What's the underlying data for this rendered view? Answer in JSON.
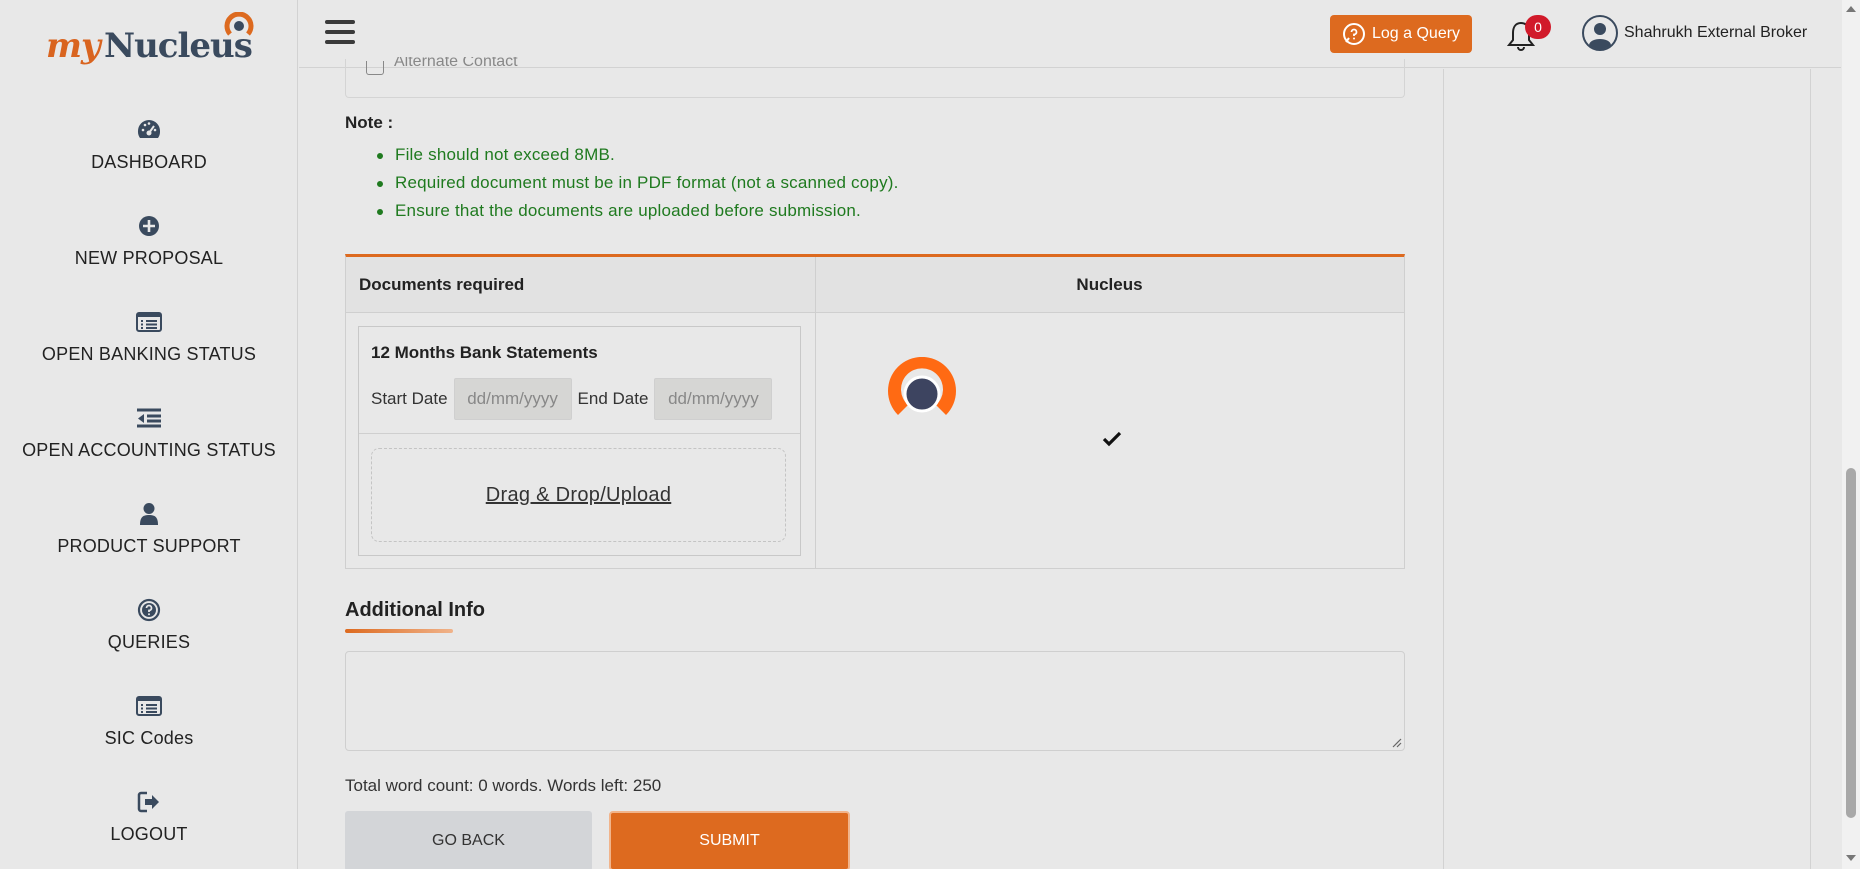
{
  "brand": {
    "logo_my": "my",
    "logo_nucleus": "Nucleus",
    "accent": "#dd6a1f",
    "dark": "#3a4a5e"
  },
  "sidebar": {
    "items": [
      {
        "label": "DASHBOARD",
        "icon": "dashboard-gauge-icon"
      },
      {
        "label": "NEW PROPOSAL",
        "icon": "plus-circle-icon"
      },
      {
        "label": "OPEN BANKING STATUS",
        "icon": "list-card-icon"
      },
      {
        "label": "OPEN ACCOUNTING STATUS",
        "icon": "indent-list-icon"
      },
      {
        "label": "PRODUCT SUPPORT",
        "icon": "user-icon"
      },
      {
        "label": "QUERIES",
        "icon": "question-circle-icon"
      },
      {
        "label": "SIC Codes",
        "icon": "list-card-icon"
      },
      {
        "label": "LOGOUT",
        "icon": "logout-icon"
      }
    ]
  },
  "header": {
    "log_query_label": "Log a Query",
    "notification_count": "0",
    "user_name": "Shahrukh External Broker"
  },
  "form": {
    "alternate_contact_label": "Alternate Contact",
    "note_title": "Note :",
    "notes": [
      "File should not exceed 8MB.",
      "Required document must be in PDF format (not a scanned copy).",
      "Ensure that the documents are uploaded before submission."
    ],
    "table": {
      "col1_header": "Documents required",
      "col2_header": "Nucleus",
      "doc_title": "12 Months Bank Statements",
      "start_date_label": "Start Date",
      "end_date_label": "End Date",
      "date_placeholder": "dd/mm/yyyy",
      "upload_label": "Drag & Drop/Upload"
    },
    "additional_info_title": "Additional Info",
    "additional_info_value": "",
    "word_count_text": "Total word count: 0 words. Words left: 250",
    "go_back_label": "GO BACK",
    "submit_label": "SUBMIT"
  }
}
